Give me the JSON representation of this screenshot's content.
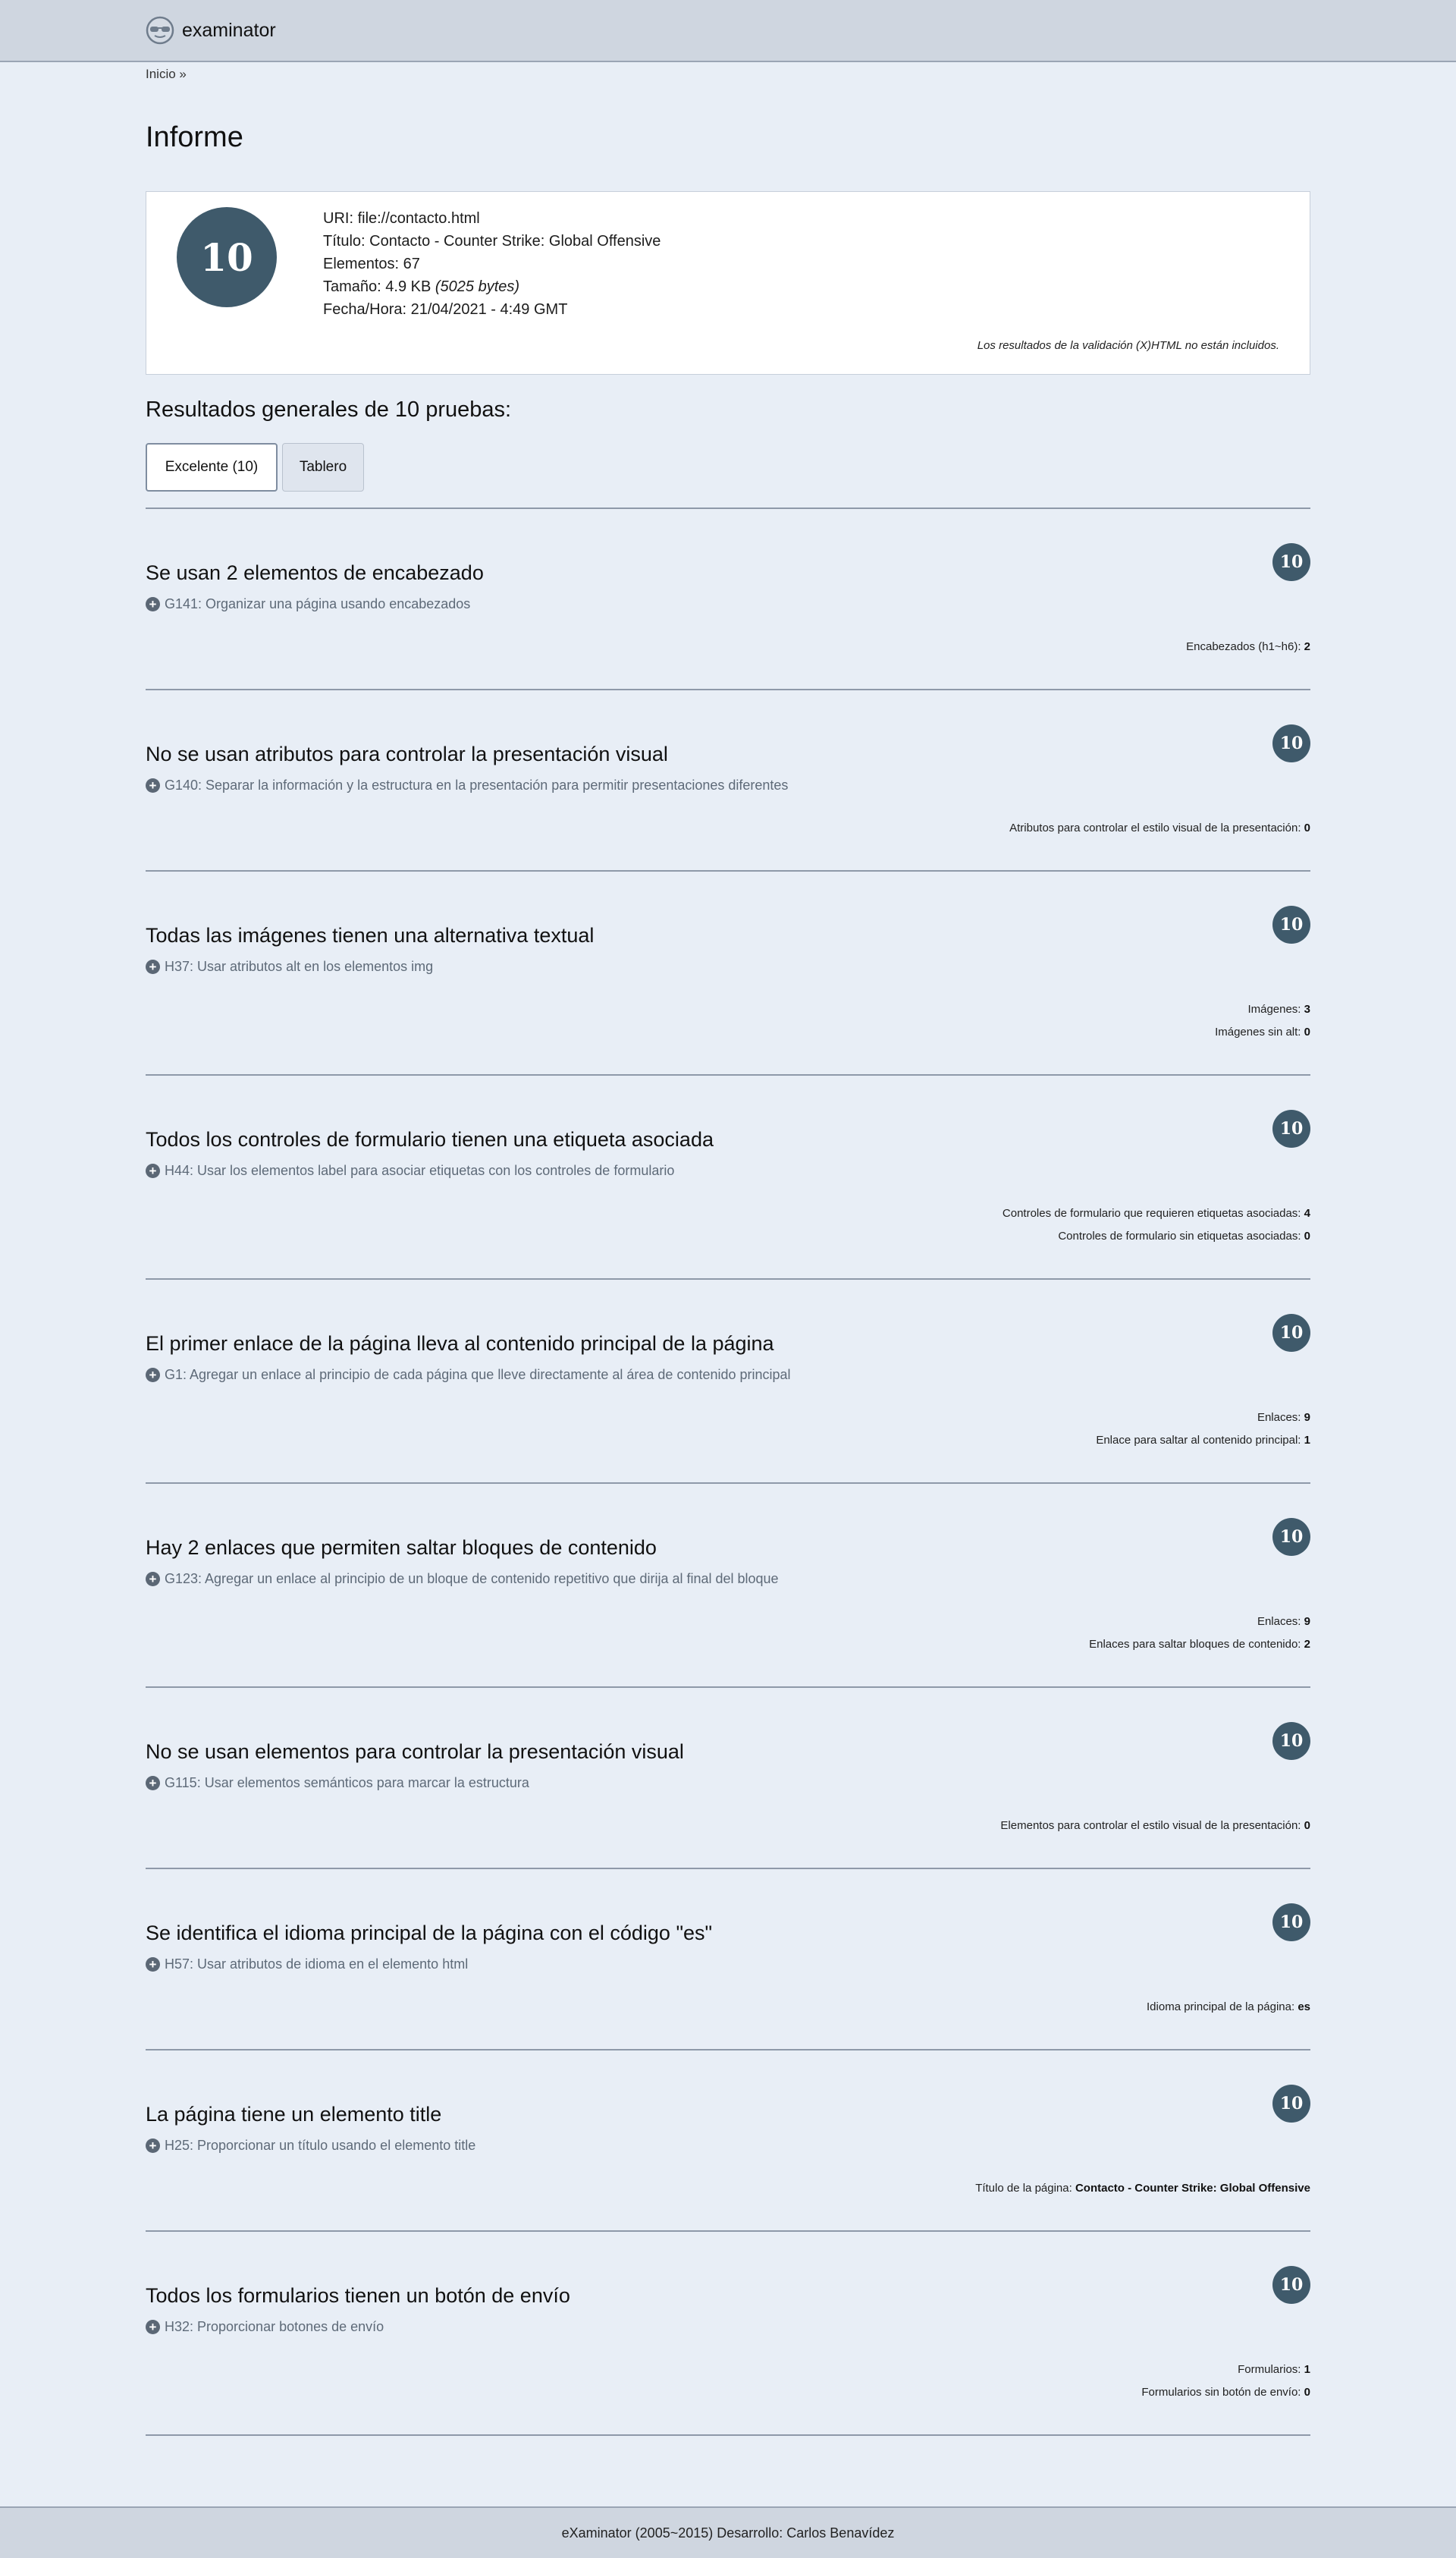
{
  "header": {
    "brand": "examinator"
  },
  "breadcrumb": {
    "home": "Inicio",
    "separator": "»"
  },
  "page_title": "Informe",
  "summary": {
    "score": "10",
    "uri_label": "URI:",
    "uri": "file://contacto.html",
    "title_label": "Título:",
    "title": "Contacto - Counter Strike: Global Offensive",
    "elements_label": "Elementos:",
    "elements": "67",
    "size_label": "Tamaño:",
    "size": "4.9 KB",
    "size_bytes": "(5025 bytes)",
    "datetime_label": "Fecha/Hora:",
    "datetime": "21/04/2021 - 4:49 GMT",
    "note": "Los resultados de la validación (X)HTML no están incluidos."
  },
  "overall": {
    "title": "Resultados generales de 10 pruebas:"
  },
  "tabs": [
    {
      "label": "Excelente (10)",
      "active": true
    },
    {
      "label": "Tablero",
      "active": false
    }
  ],
  "tests": [
    {
      "title": "Se usan 2 elementos de encabezado",
      "score": "10",
      "technique": "G141: Organizar una página usando encabezados",
      "results": [
        {
          "label": "Encabezados (h1~h6):",
          "value": "2"
        }
      ]
    },
    {
      "title": "No se usan atributos para controlar la presentación visual",
      "score": "10",
      "technique": "G140: Separar la información y la estructura en la presentación para permitir presentaciones diferentes",
      "results": [
        {
          "label": "Atributos para controlar el estilo visual de la presentación:",
          "value": "0"
        }
      ]
    },
    {
      "title": "Todas las imágenes tienen una alternativa textual",
      "score": "10",
      "technique": "H37: Usar atributos alt en los elementos img",
      "results": [
        {
          "label": "Imágenes:",
          "value": "3"
        },
        {
          "label": "Imágenes sin alt:",
          "value": "0"
        }
      ]
    },
    {
      "title": "Todos los controles de formulario tienen una etiqueta asociada",
      "score": "10",
      "technique": "H44: Usar los elementos label para asociar etiquetas con los controles de formulario",
      "results": [
        {
          "label": "Controles de formulario que requieren etiquetas asociadas:",
          "value": "4"
        },
        {
          "label": "Controles de formulario sin etiquetas asociadas:",
          "value": "0"
        }
      ]
    },
    {
      "title": "El primer enlace de la página lleva al contenido principal de la página",
      "score": "10",
      "technique": "G1: Agregar un enlace al principio de cada página que lleve directamente al área de contenido principal",
      "results": [
        {
          "label": "Enlaces:",
          "value": "9"
        },
        {
          "label": "Enlace para saltar al contenido principal:",
          "value": "1"
        }
      ]
    },
    {
      "title": "Hay 2 enlaces que permiten saltar bloques de contenido",
      "score": "10",
      "technique": "G123: Agregar un enlace al principio de un bloque de contenido repetitivo que dirija al final del bloque",
      "results": [
        {
          "label": "Enlaces:",
          "value": "9"
        },
        {
          "label": "Enlaces para saltar bloques de contenido:",
          "value": "2"
        }
      ]
    },
    {
      "title": "No se usan elementos para controlar la presentación visual",
      "score": "10",
      "technique": "G115: Usar elementos semánticos para marcar la estructura",
      "results": [
        {
          "label": "Elementos para controlar el estilo visual de la presentación:",
          "value": "0"
        }
      ]
    },
    {
      "title": "Se identifica el idioma principal de la página con el código \"es\"",
      "score": "10",
      "technique": "H57: Usar atributos de idioma en el elemento html",
      "results": [
        {
          "label": "Idioma principal de la página:",
          "value": "es"
        }
      ]
    },
    {
      "title": "La página tiene un elemento title",
      "score": "10",
      "technique": "H25: Proporcionar un título usando el elemento title",
      "results": [
        {
          "label": "Título de la página:",
          "value": "Contacto - Counter Strike: Global Offensive"
        }
      ]
    },
    {
      "title": "Todos los formularios tienen un botón de envío",
      "score": "10",
      "technique": "H32: Proporcionar botones de envío",
      "results": [
        {
          "label": "Formularios:",
          "value": "1"
        },
        {
          "label": "Formularios sin botón de envío:",
          "value": "0"
        }
      ]
    }
  ],
  "footer": {
    "text": "eXaminator (2005~2015) Desarrollo: Carlos Benavídez"
  }
}
